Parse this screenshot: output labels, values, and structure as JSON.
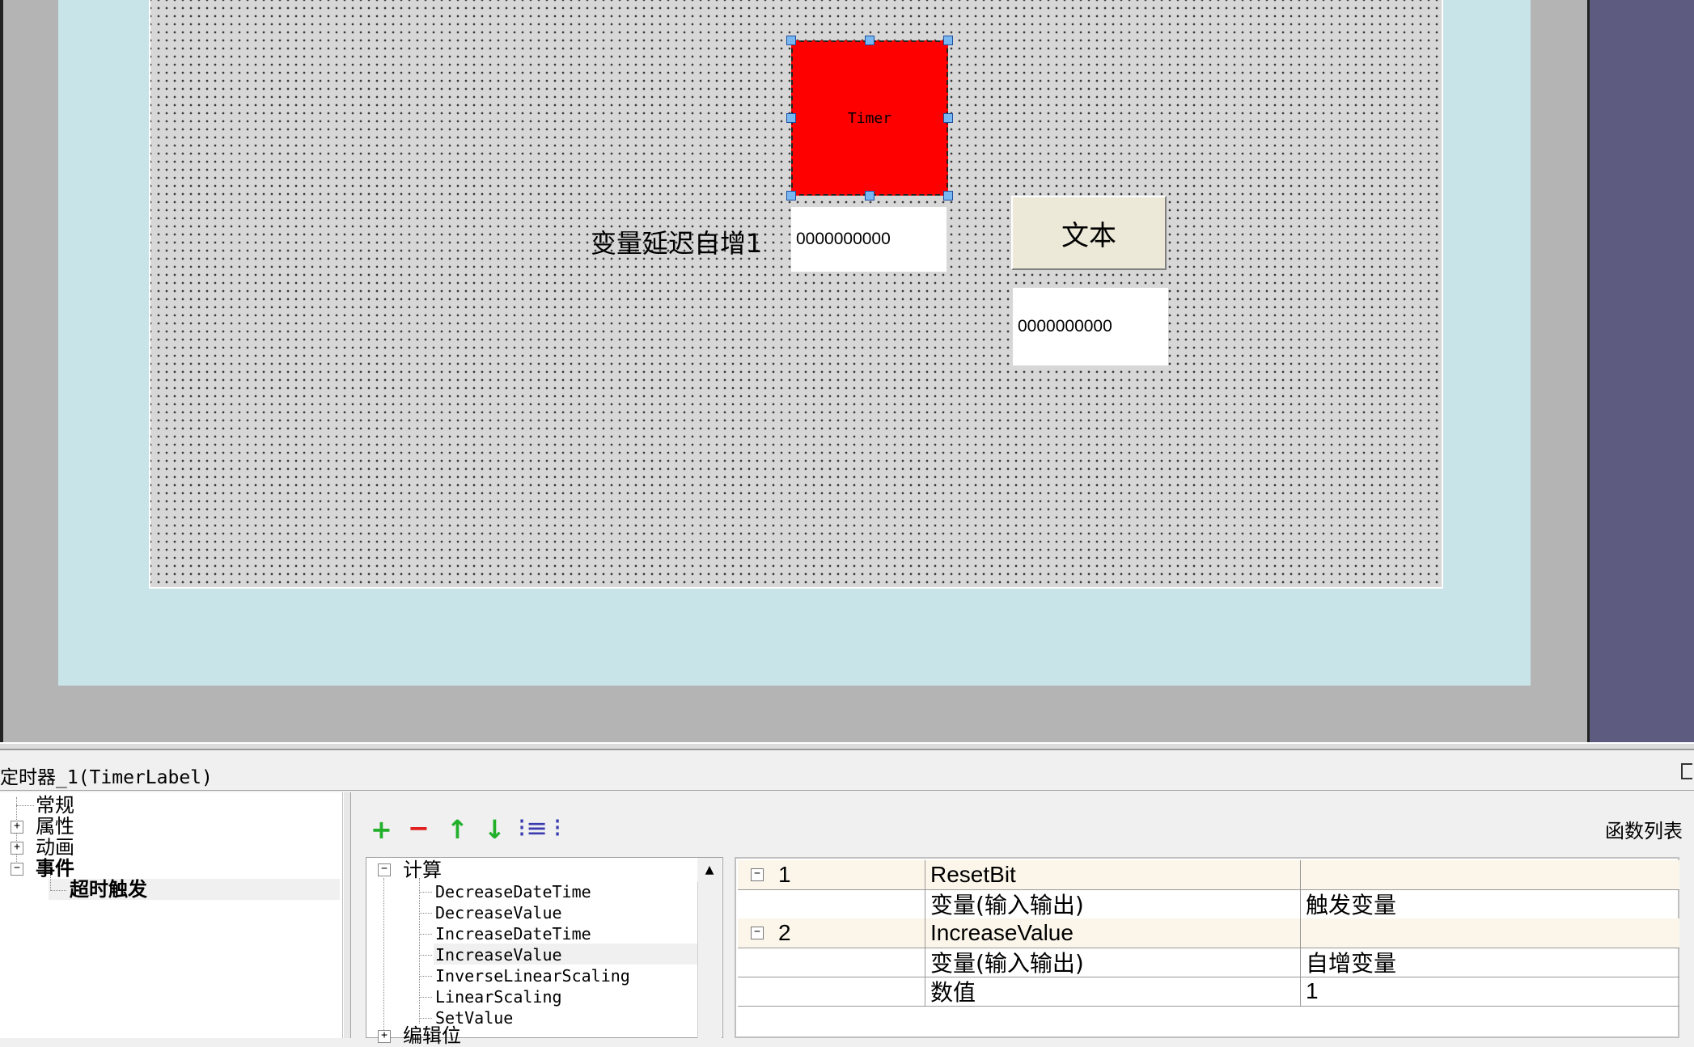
{
  "canvas": {
    "timer_label": "Timer",
    "variable_label": "变量延迟自增1",
    "value_box_1": "0000000000",
    "text_button": "文本",
    "value_box_2": "0000000000"
  },
  "panel": {
    "title": "定时器_1(TimerLabel)"
  },
  "left_tree": {
    "items": [
      {
        "label": "常规"
      },
      {
        "label": "属性"
      },
      {
        "label": "动画"
      },
      {
        "label": "事件"
      },
      {
        "label": "超时触发"
      }
    ]
  },
  "toolbar": {
    "icons": [
      "add-icon",
      "remove-icon",
      "move-up-icon",
      "move-down-icon",
      "indent-icon",
      "outdent-icon"
    ],
    "func_list_label": "函数列表"
  },
  "func_tree": {
    "category": "计算",
    "items": [
      "DecreaseDateTime",
      "DecreaseValue",
      "IncreaseDateTime",
      "IncreaseValue",
      "InverseLinearScaling",
      "LinearScaling",
      "SetValue"
    ],
    "next_category": "编辑位"
  },
  "action_grid": {
    "rows": [
      {
        "expander": "−",
        "index": "1",
        "function": "ResetBit",
        "param": "",
        "value": ""
      },
      {
        "expander": "",
        "index": "",
        "function": "变量(输入输出)",
        "param": "触发变量",
        "value": ""
      },
      {
        "expander": "−",
        "index": "2",
        "function": "IncreaseValue",
        "param": "",
        "value": ""
      },
      {
        "expander": "",
        "index": "",
        "function": "变量(输入输出)",
        "param": "自增变量",
        "value": ""
      },
      {
        "expander": "",
        "index": "",
        "function": "数值",
        "param": "1",
        "value": ""
      }
    ]
  },
  "colors": {
    "timer_fill": "#ff0000",
    "canvas_bg": "#d7d7d7",
    "screen_frame": "#c8e4e8",
    "right_bar": "#5d5b80",
    "grid_head_row": "#fbf6e9"
  }
}
